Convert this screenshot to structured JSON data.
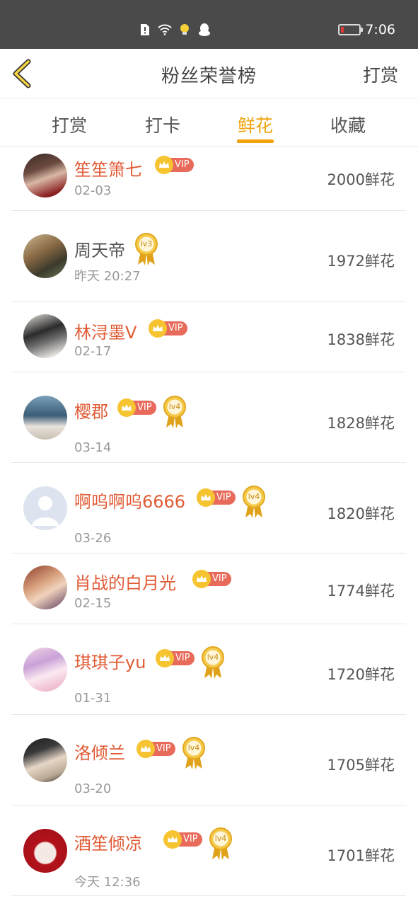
{
  "status_bar": {
    "time": "7:06",
    "icons": [
      "sim-alert-icon",
      "wifi-icon",
      "bulb-icon",
      "qq-penguin-icon"
    ]
  },
  "header": {
    "title": "粉丝荣誉榜",
    "right_action": "打赏"
  },
  "tabs": [
    {
      "label": "打赏",
      "active": false
    },
    {
      "label": "打卡",
      "active": false
    },
    {
      "label": "鲜花",
      "active": true
    },
    {
      "label": "收藏",
      "active": false
    }
  ],
  "accent_color": "#f0a30a",
  "fans": [
    {
      "name": "笙笙箫七",
      "date": "02-03",
      "amount": "2000鲜花",
      "vip": "VIP",
      "level": ""
    },
    {
      "name": "周天帝",
      "date": "昨天 20:27",
      "amount": "1972鲜花",
      "vip": "",
      "level": "lv3"
    },
    {
      "name": "林浔墨V",
      "date": "02-17",
      "amount": "1838鲜花",
      "vip": "VIP",
      "level": ""
    },
    {
      "name": "樱郡",
      "date": "03-14",
      "amount": "1828鲜花",
      "vip": "VIP",
      "level": "lv4"
    },
    {
      "name": "啊呜啊呜6666",
      "date": "03-26",
      "amount": "1820鲜花",
      "vip": "VIP",
      "level": "lv4"
    },
    {
      "name": "肖战的白月光",
      "date": "02-15",
      "amount": "1774鲜花",
      "vip": "VIP",
      "level": ""
    },
    {
      "name": "琪琪子yu",
      "date": "01-31",
      "amount": "1720鲜花",
      "vip": "VIP",
      "level": "lv4"
    },
    {
      "name": "洛倾兰",
      "date": "03-20",
      "amount": "1705鲜花",
      "vip": "VIP",
      "level": "lv4"
    },
    {
      "name": "酒笙倾凉",
      "date": "今天 12:36",
      "amount": "1701鲜花",
      "vip": "VIP",
      "level": "lv4"
    }
  ]
}
